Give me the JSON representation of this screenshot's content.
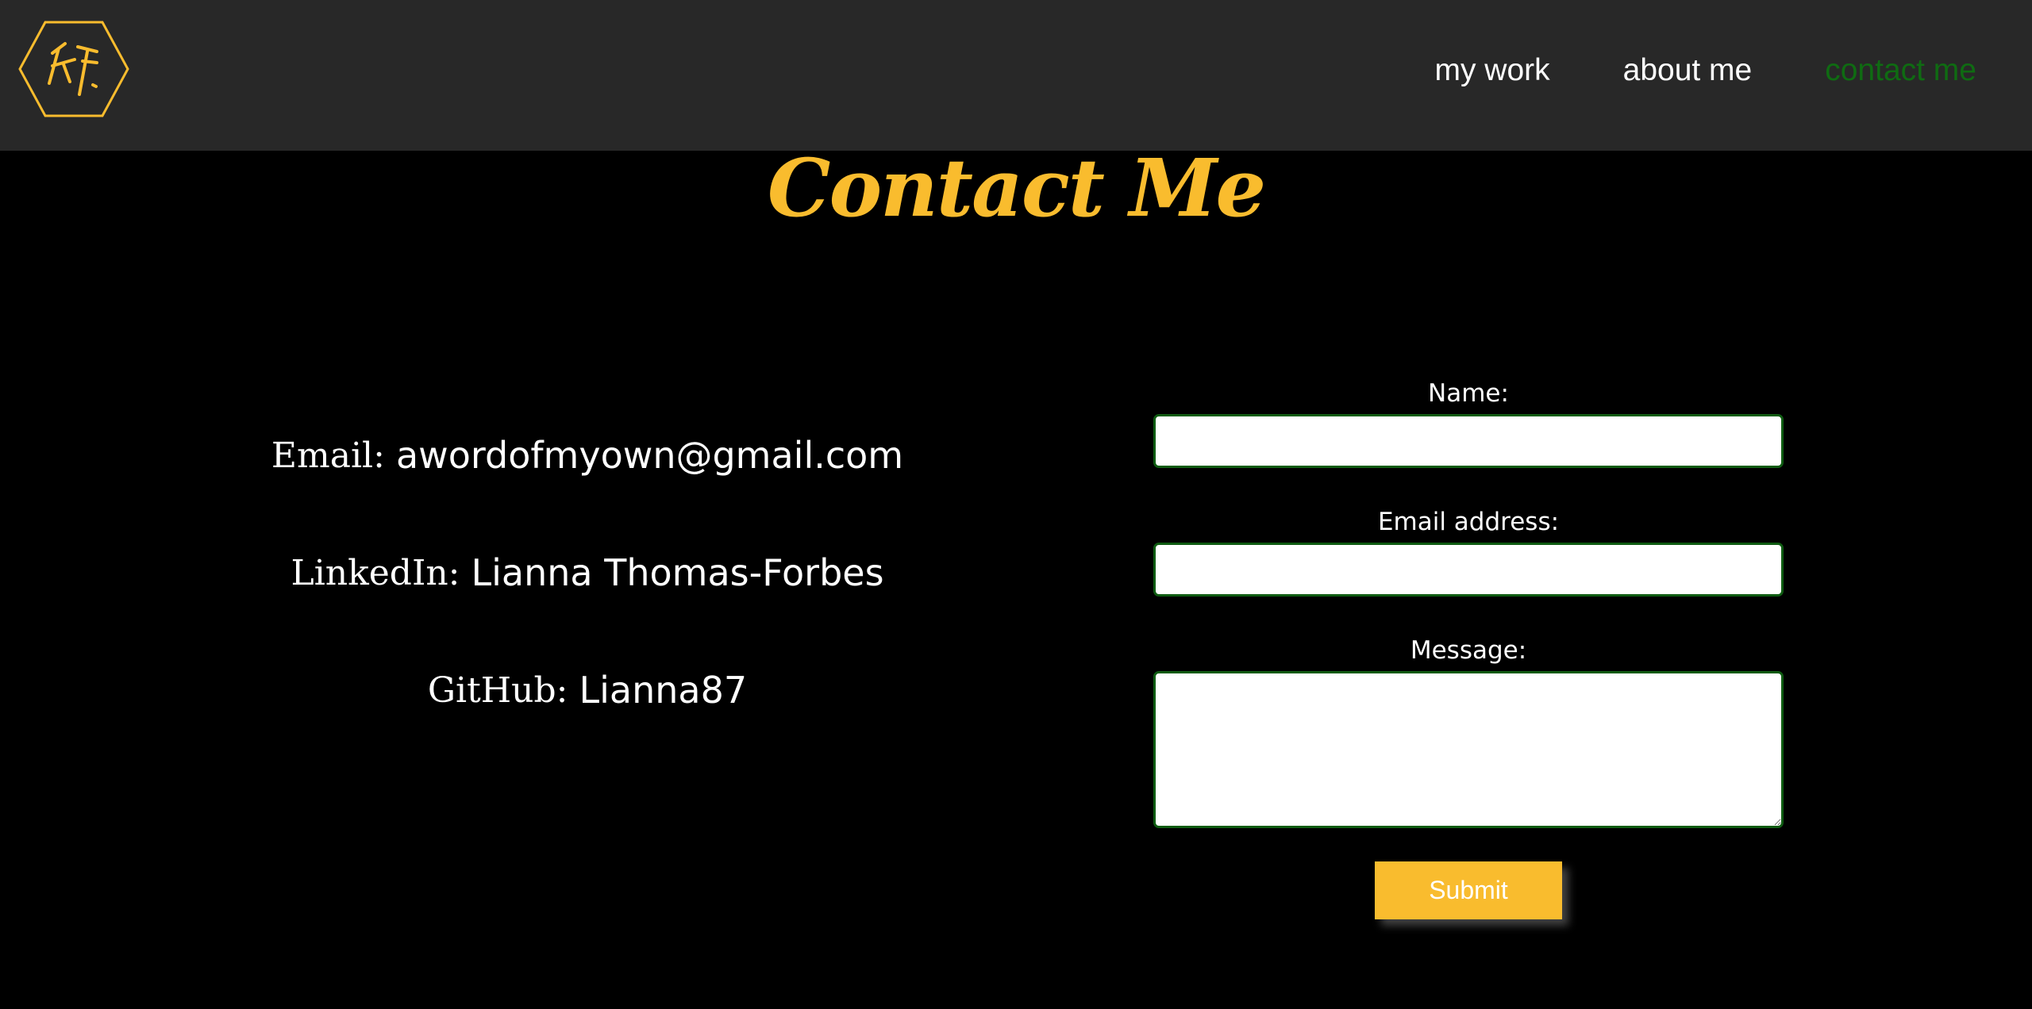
{
  "header": {
    "logo_icon": "hexagon-monogram-logo",
    "nav": [
      {
        "label": "my work",
        "active": false
      },
      {
        "label": "about me",
        "active": false
      },
      {
        "label": "contact me",
        "active": true
      }
    ]
  },
  "main": {
    "title": "Contact Me",
    "contact_info": [
      {
        "label": "Email:",
        "value": "awordofmyown@gmail.com"
      },
      {
        "label": "LinkedIn:",
        "value": "Lianna Thomas-Forbes"
      },
      {
        "label": "GitHub:",
        "value": "Lianna87"
      }
    ],
    "form": {
      "name_label": "Name:",
      "name_value": "",
      "email_label": "Email address:",
      "email_value": "",
      "message_label": "Message:",
      "message_value": "",
      "submit_label": "Submit"
    }
  },
  "colors": {
    "accent": "#f9bc2e",
    "nav_bg": "#282828",
    "active_link": "#0f6b12",
    "input_border": "#0f5c12",
    "page_bg": "#000000"
  }
}
